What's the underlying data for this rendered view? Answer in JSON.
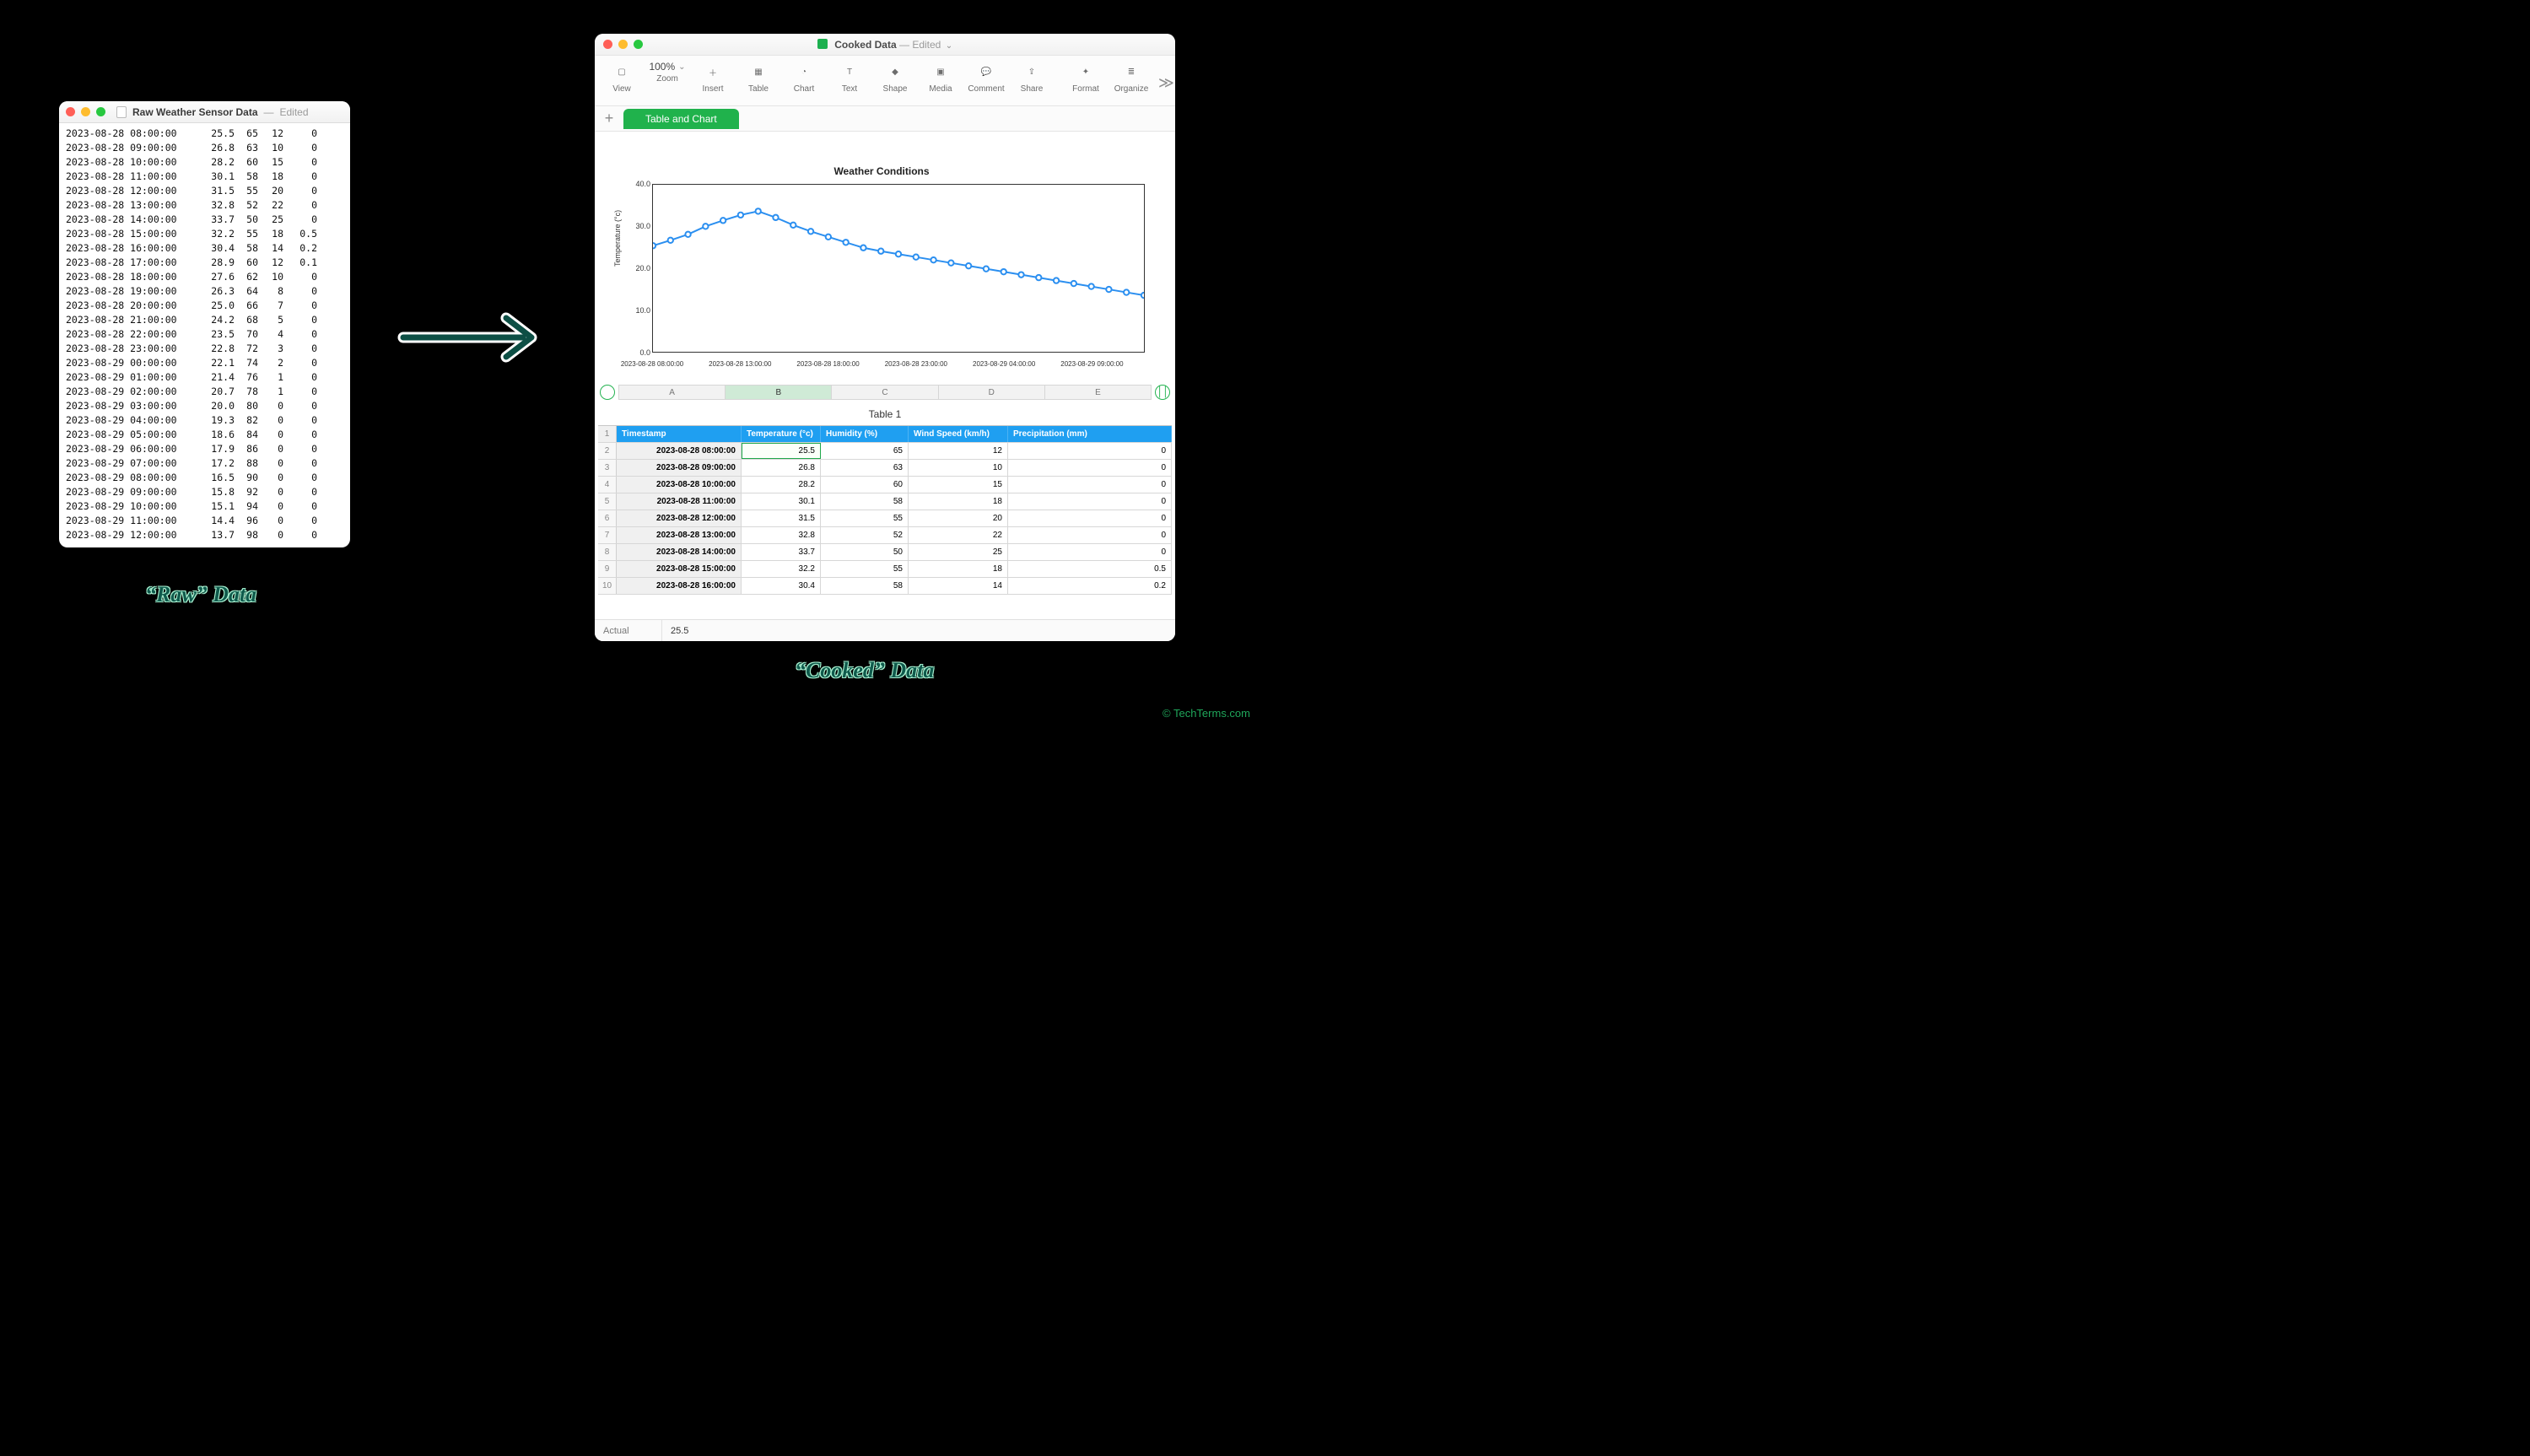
{
  "raw_window": {
    "title": "Raw Weather Sensor Data",
    "status": "Edited",
    "rows": [
      {
        "ts": "2023-08-28 08:00:00",
        "temp": "25.5",
        "hum": "65",
        "wind": "12",
        "prec": "0"
      },
      {
        "ts": "2023-08-28 09:00:00",
        "temp": "26.8",
        "hum": "63",
        "wind": "10",
        "prec": "0"
      },
      {
        "ts": "2023-08-28 10:00:00",
        "temp": "28.2",
        "hum": "60",
        "wind": "15",
        "prec": "0"
      },
      {
        "ts": "2023-08-28 11:00:00",
        "temp": "30.1",
        "hum": "58",
        "wind": "18",
        "prec": "0"
      },
      {
        "ts": "2023-08-28 12:00:00",
        "temp": "31.5",
        "hum": "55",
        "wind": "20",
        "prec": "0"
      },
      {
        "ts": "2023-08-28 13:00:00",
        "temp": "32.8",
        "hum": "52",
        "wind": "22",
        "prec": "0"
      },
      {
        "ts": "2023-08-28 14:00:00",
        "temp": "33.7",
        "hum": "50",
        "wind": "25",
        "prec": "0"
      },
      {
        "ts": "2023-08-28 15:00:00",
        "temp": "32.2",
        "hum": "55",
        "wind": "18",
        "prec": "0.5"
      },
      {
        "ts": "2023-08-28 16:00:00",
        "temp": "30.4",
        "hum": "58",
        "wind": "14",
        "prec": "0.2"
      },
      {
        "ts": "2023-08-28 17:00:00",
        "temp": "28.9",
        "hum": "60",
        "wind": "12",
        "prec": "0.1"
      },
      {
        "ts": "2023-08-28 18:00:00",
        "temp": "27.6",
        "hum": "62",
        "wind": "10",
        "prec": "0"
      },
      {
        "ts": "2023-08-28 19:00:00",
        "temp": "26.3",
        "hum": "64",
        "wind": "8",
        "prec": "0"
      },
      {
        "ts": "2023-08-28 20:00:00",
        "temp": "25.0",
        "hum": "66",
        "wind": "7",
        "prec": "0"
      },
      {
        "ts": "2023-08-28 21:00:00",
        "temp": "24.2",
        "hum": "68",
        "wind": "5",
        "prec": "0"
      },
      {
        "ts": "2023-08-28 22:00:00",
        "temp": "23.5",
        "hum": "70",
        "wind": "4",
        "prec": "0"
      },
      {
        "ts": "2023-08-28 23:00:00",
        "temp": "22.8",
        "hum": "72",
        "wind": "3",
        "prec": "0"
      },
      {
        "ts": "2023-08-29 00:00:00",
        "temp": "22.1",
        "hum": "74",
        "wind": "2",
        "prec": "0"
      },
      {
        "ts": "2023-08-29 01:00:00",
        "temp": "21.4",
        "hum": "76",
        "wind": "1",
        "prec": "0"
      },
      {
        "ts": "2023-08-29 02:00:00",
        "temp": "20.7",
        "hum": "78",
        "wind": "1",
        "prec": "0"
      },
      {
        "ts": "2023-08-29 03:00:00",
        "temp": "20.0",
        "hum": "80",
        "wind": "0",
        "prec": "0"
      },
      {
        "ts": "2023-08-29 04:00:00",
        "temp": "19.3",
        "hum": "82",
        "wind": "0",
        "prec": "0"
      },
      {
        "ts": "2023-08-29 05:00:00",
        "temp": "18.6",
        "hum": "84",
        "wind": "0",
        "prec": "0"
      },
      {
        "ts": "2023-08-29 06:00:00",
        "temp": "17.9",
        "hum": "86",
        "wind": "0",
        "prec": "0"
      },
      {
        "ts": "2023-08-29 07:00:00",
        "temp": "17.2",
        "hum": "88",
        "wind": "0",
        "prec": "0"
      },
      {
        "ts": "2023-08-29 08:00:00",
        "temp": "16.5",
        "hum": "90",
        "wind": "0",
        "prec": "0"
      },
      {
        "ts": "2023-08-29 09:00:00",
        "temp": "15.8",
        "hum": "92",
        "wind": "0",
        "prec": "0"
      },
      {
        "ts": "2023-08-29 10:00:00",
        "temp": "15.1",
        "hum": "94",
        "wind": "0",
        "prec": "0"
      },
      {
        "ts": "2023-08-29 11:00:00",
        "temp": "14.4",
        "hum": "96",
        "wind": "0",
        "prec": "0"
      },
      {
        "ts": "2023-08-29 12:00:00",
        "temp": "13.7",
        "hum": "98",
        "wind": "0",
        "prec": "0"
      }
    ]
  },
  "cooked_window": {
    "title": "Cooked Data",
    "status": "Edited",
    "zoom": "100%",
    "toolbar": [
      "View",
      "Zoom",
      "Insert",
      "Table",
      "Chart",
      "Text",
      "Shape",
      "Media",
      "Comment",
      "Share",
      "Format",
      "Organize"
    ],
    "sheet_tab": "Table and Chart",
    "chart_title": "Weather Conditions",
    "ylabel": "Temperature (°c)",
    "yticks": [
      "0.0",
      "10.0",
      "20.0",
      "30.0",
      "40.0"
    ],
    "xticks": [
      "2023-08-28 08:00:00",
      "2023-08-28 13:00:00",
      "2023-08-28 18:00:00",
      "2023-08-28 23:00:00",
      "2023-08-29 04:00:00",
      "2023-08-29 09:00:00"
    ],
    "columns_letters": [
      "A",
      "B",
      "C",
      "D",
      "E"
    ],
    "table_title": "Table 1",
    "headers": [
      "Timestamp",
      "Temperature (°c)",
      "Humidity (%)",
      "Wind Speed (km/h)",
      "Precipitation (mm)"
    ],
    "visible_rows": [
      {
        "n": "2",
        "ts": "2023-08-28 08:00:00",
        "temp": "25.5",
        "hum": "65",
        "wind": "12",
        "prec": "0"
      },
      {
        "n": "3",
        "ts": "2023-08-28 09:00:00",
        "temp": "26.8",
        "hum": "63",
        "wind": "10",
        "prec": "0"
      },
      {
        "n": "4",
        "ts": "2023-08-28 10:00:00",
        "temp": "28.2",
        "hum": "60",
        "wind": "15",
        "prec": "0"
      },
      {
        "n": "5",
        "ts": "2023-08-28 11:00:00",
        "temp": "30.1",
        "hum": "58",
        "wind": "18",
        "prec": "0"
      },
      {
        "n": "6",
        "ts": "2023-08-28 12:00:00",
        "temp": "31.5",
        "hum": "55",
        "wind": "20",
        "prec": "0"
      },
      {
        "n": "7",
        "ts": "2023-08-28 13:00:00",
        "temp": "32.8",
        "hum": "52",
        "wind": "22",
        "prec": "0"
      },
      {
        "n": "8",
        "ts": "2023-08-28 14:00:00",
        "temp": "33.7",
        "hum": "50",
        "wind": "25",
        "prec": "0"
      },
      {
        "n": "9",
        "ts": "2023-08-28 15:00:00",
        "temp": "32.2",
        "hum": "55",
        "wind": "18",
        "prec": "0.5"
      },
      {
        "n": "10",
        "ts": "2023-08-28 16:00:00",
        "temp": "30.4",
        "hum": "58",
        "wind": "14",
        "prec": "0.2"
      }
    ],
    "formula_label": "Actual",
    "formula_value": "25.5"
  },
  "labels": {
    "raw": "“Raw” Data",
    "cooked": "“Cooked” Data",
    "credit": "© TechTerms.com"
  },
  "chart_data": {
    "type": "line",
    "title": "Weather Conditions",
    "xlabel": "",
    "ylabel": "Temperature (°c)",
    "ylim": [
      0,
      40
    ],
    "x": [
      "2023-08-28 08:00:00",
      "2023-08-28 09:00:00",
      "2023-08-28 10:00:00",
      "2023-08-28 11:00:00",
      "2023-08-28 12:00:00",
      "2023-08-28 13:00:00",
      "2023-08-28 14:00:00",
      "2023-08-28 15:00:00",
      "2023-08-28 16:00:00",
      "2023-08-28 17:00:00",
      "2023-08-28 18:00:00",
      "2023-08-28 19:00:00",
      "2023-08-28 20:00:00",
      "2023-08-28 21:00:00",
      "2023-08-28 22:00:00",
      "2023-08-28 23:00:00",
      "2023-08-29 00:00:00",
      "2023-08-29 01:00:00",
      "2023-08-29 02:00:00",
      "2023-08-29 03:00:00",
      "2023-08-29 04:00:00",
      "2023-08-29 05:00:00",
      "2023-08-29 06:00:00",
      "2023-08-29 07:00:00",
      "2023-08-29 08:00:00",
      "2023-08-29 09:00:00",
      "2023-08-29 10:00:00",
      "2023-08-29 11:00:00",
      "2023-08-29 12:00:00"
    ],
    "values": [
      25.5,
      26.8,
      28.2,
      30.1,
      31.5,
      32.8,
      33.7,
      32.2,
      30.4,
      28.9,
      27.6,
      26.3,
      25.0,
      24.2,
      23.5,
      22.8,
      22.1,
      21.4,
      20.7,
      20.0,
      19.3,
      18.6,
      17.9,
      17.2,
      16.5,
      15.8,
      15.1,
      14.4,
      13.7
    ]
  }
}
